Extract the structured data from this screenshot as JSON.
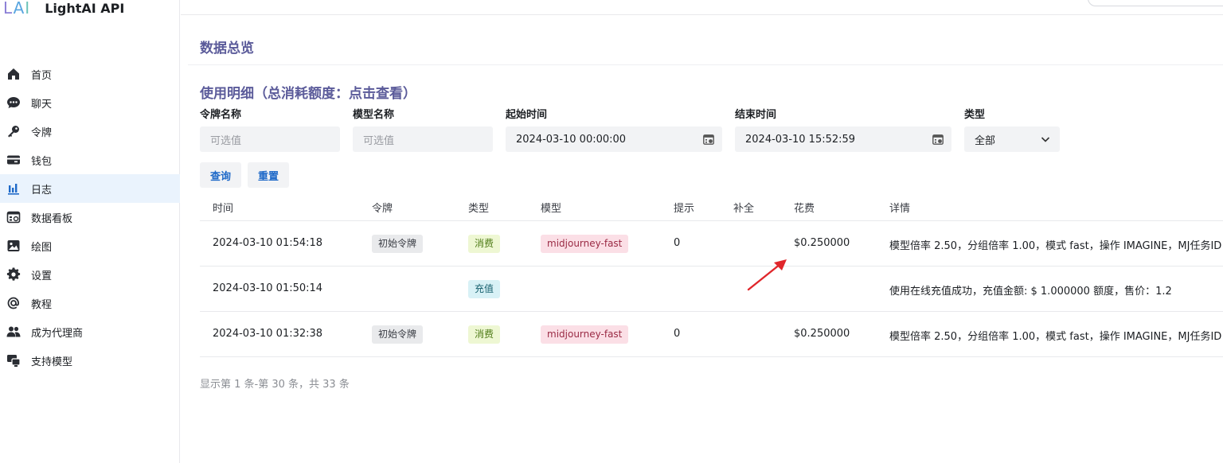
{
  "brand": {
    "logo_text": "LAI",
    "title": "LightAI API"
  },
  "sidebar": {
    "items": [
      {
        "label": "首页",
        "icon": "home-icon",
        "active": false
      },
      {
        "label": "聊天",
        "icon": "chat-icon",
        "active": false
      },
      {
        "label": "令牌",
        "icon": "key-icon",
        "active": false
      },
      {
        "label": "钱包",
        "icon": "wallet-icon",
        "active": false
      },
      {
        "label": "日志",
        "icon": "bar-chart-icon",
        "active": true
      },
      {
        "label": "数据看板",
        "icon": "dashboard-icon",
        "active": false
      },
      {
        "label": "绘图",
        "icon": "image-icon",
        "active": false
      },
      {
        "label": "设置",
        "icon": "gear-icon",
        "active": false
      },
      {
        "label": "教程",
        "icon": "at-icon",
        "active": false
      },
      {
        "label": "成为代理商",
        "icon": "users-icon",
        "active": false
      },
      {
        "label": "支持模型",
        "icon": "model-icon",
        "active": false
      }
    ]
  },
  "main": {
    "page_title": "数据总览",
    "section_title": "使用明细（总消耗额度：点击查看）",
    "filters": {
      "token": {
        "label": "令牌名称",
        "placeholder": "可选值"
      },
      "model": {
        "label": "模型名称",
        "placeholder": "可选值"
      },
      "start": {
        "label": "起始时间",
        "value": "2024-03-10 00:00:00"
      },
      "end": {
        "label": "结束时间",
        "value": "2024-03-10 15:52:59"
      },
      "type": {
        "label": "类型",
        "value": "全部"
      }
    },
    "buttons": {
      "query": "查询",
      "reset": "重置"
    },
    "table": {
      "headers": {
        "time": "时间",
        "token": "令牌",
        "type": "类型",
        "model": "模型",
        "prompt": "提示",
        "completion": "补全",
        "cost": "花费",
        "detail": "详情"
      },
      "rows": [
        {
          "time": "2024-03-10 01:54:18",
          "token": "初始令牌",
          "type": "消费",
          "model": "midjourney-fast",
          "prompt": "0",
          "completion": "",
          "cost": "$0.250000",
          "detail": "模型倍率 2.50，分组倍率 1.00，模式 fast，操作 IMAGINE，MJ任务ID"
        },
        {
          "time": "2024-03-10 01:50:14",
          "token": "",
          "type": "充值",
          "model": "",
          "prompt": "",
          "completion": "",
          "cost": "",
          "detail": "使用在线充值成功，充值金额: $ 1.000000 额度，售价：1.2"
        },
        {
          "time": "2024-03-10 01:32:38",
          "token": "初始令牌",
          "type": "消费",
          "model": "midjourney-fast",
          "prompt": "0",
          "completion": "",
          "cost": "$0.250000",
          "detail": "模型倍率 2.50，分组倍率 1.00，模式 fast，操作 IMAGINE，MJ任务ID"
        }
      ]
    },
    "pagination": "显示第 1 条-第 30 条，共 33 条"
  },
  "colors": {
    "accent": "#1e69c8",
    "title": "#5b5b9a",
    "annotation_arrow": "#e0262b"
  }
}
